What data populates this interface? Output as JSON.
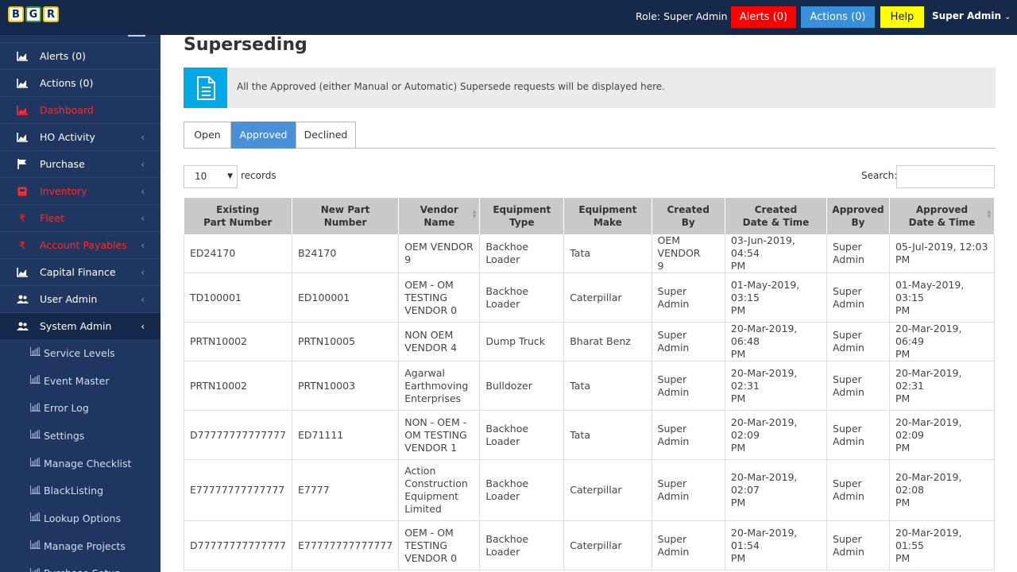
{
  "header": {
    "logo_letters": [
      "B",
      "G",
      "R"
    ],
    "role": "Role: Super Admin",
    "alerts_label": "Alerts (0)",
    "actions_label": "Actions (0)",
    "help_label": "Help",
    "user_label": "Super Admin"
  },
  "sidebar": {
    "items": [
      {
        "label": "Alerts (0)",
        "icon": "chart-icon",
        "color": "#ffffff"
      },
      {
        "label": "Actions (0)",
        "icon": "chart-icon",
        "color": "#ffffff"
      },
      {
        "label": "Dashboard",
        "icon": "chart-icon",
        "color": "#ff2a2a"
      },
      {
        "label": "HO Activity",
        "icon": "chart-icon",
        "color": "#ffffff"
      },
      {
        "label": "Purchase",
        "icon": "flag-icon",
        "color": "#ffffff"
      },
      {
        "label": "Inventory",
        "icon": "box-icon",
        "color": "#ff2a2a"
      },
      {
        "label": "Fleet",
        "icon": "rupee-icon",
        "color": "#ff2a2a"
      },
      {
        "label": "Account Payables",
        "icon": "rupee-icon",
        "color": "#ff2a2a"
      },
      {
        "label": "Capital Finance",
        "icon": "chart-icon",
        "color": "#ffffff"
      },
      {
        "label": "User Admin",
        "icon": "users-icon",
        "color": "#ffffff"
      },
      {
        "label": "System Admin",
        "icon": "users-icon",
        "color": "#ffffff"
      }
    ],
    "subitems": [
      "Service Levels",
      "Event Master",
      "Error Log",
      "Settings",
      "Manage Checklist",
      "BlackListing",
      "Lookup Options",
      "Manage Projects",
      "Purchase Setup"
    ]
  },
  "main": {
    "title": "Superseding",
    "info_text": "All the Approved (either Manual or Automatic) Supersede requests will be displayed here.",
    "tabs": [
      "Open",
      "Approved",
      "Declined"
    ],
    "page_length": "10",
    "records_label": "records",
    "search_label": "Search:"
  },
  "table": {
    "headers": [
      [
        "Existing",
        "Part Number"
      ],
      [
        "New Part",
        "Number"
      ],
      [
        "Vendor Name",
        ""
      ],
      [
        "Equipment Type",
        ""
      ],
      [
        "Equipment Make",
        ""
      ],
      [
        "Created",
        "By"
      ],
      [
        "Created",
        "Date & Time"
      ],
      [
        "Approved",
        "By"
      ],
      [
        "Approved",
        "Date & Time"
      ]
    ],
    "rows": [
      {
        "existing": "ED24170",
        "new": "B24170",
        "vendor": [
          "OEM VENDOR",
          "9"
        ],
        "type": "Backhoe Loader",
        "make": "Tata",
        "created_by": [
          "OEM VENDOR",
          "9"
        ],
        "created_at": [
          "03-Jun-2019, 04:54",
          "PM"
        ],
        "approved_by": [
          "Super",
          "Admin"
        ],
        "approved_at": [
          "05-Jul-2019, 12:03",
          "PM"
        ]
      },
      {
        "existing": "TD100001",
        "new": "ED100001",
        "vendor": [
          "OEM - OM",
          "TESTING",
          "VENDOR 0"
        ],
        "type": "Backhoe Loader",
        "make": "Caterpillar",
        "created_by": [
          "Super Admin"
        ],
        "created_at": [
          "01-May-2019, 03:15",
          "PM"
        ],
        "approved_by": [
          "Super",
          "Admin"
        ],
        "approved_at": [
          "01-May-2019, 03:15",
          "PM"
        ]
      },
      {
        "existing": "PRTN10002",
        "new": "PRTN10005",
        "vendor": [
          "NON OEM",
          "VENDOR 4"
        ],
        "type": "Dump Truck",
        "make": "Bharat Benz",
        "created_by": [
          "Super Admin"
        ],
        "created_at": [
          "20-Mar-2019, 06:48",
          "PM"
        ],
        "approved_by": [
          "Super",
          "Admin"
        ],
        "approved_at": [
          "20-Mar-2019, 06:49",
          "PM"
        ]
      },
      {
        "existing": "PRTN10002",
        "new": "PRTN10003",
        "vendor": [
          "Agarwal",
          "Earthmoving",
          "Enterprises"
        ],
        "type": "Bulldozer",
        "make": "Tata",
        "created_by": [
          "Super Admin"
        ],
        "created_at": [
          "20-Mar-2019, 02:31",
          "PM"
        ],
        "approved_by": [
          "Super",
          "Admin"
        ],
        "approved_at": [
          "20-Mar-2019, 02:31",
          "PM"
        ]
      },
      {
        "existing": "D77777777777777",
        "new": "ED71111",
        "vendor": [
          "NON - OEM -",
          "OM TESTING",
          "VENDOR 1"
        ],
        "type": "Backhoe Loader",
        "make": "Tata",
        "created_by": [
          "Super Admin"
        ],
        "created_at": [
          "20-Mar-2019, 02:09",
          "PM"
        ],
        "approved_by": [
          "Super",
          "Admin"
        ],
        "approved_at": [
          "20-Mar-2019, 02:09",
          "PM"
        ]
      },
      {
        "existing": "E77777777777777",
        "new": "E7777",
        "vendor": [
          "Action",
          "Construction",
          "Equipment",
          "Limited"
        ],
        "type": "Backhoe Loader",
        "make": "Caterpillar",
        "created_by": [
          "Super Admin"
        ],
        "created_at": [
          "20-Mar-2019, 02:07",
          "PM"
        ],
        "approved_by": [
          "Super",
          "Admin"
        ],
        "approved_at": [
          "20-Mar-2019, 02:08",
          "PM"
        ]
      },
      {
        "existing": "D77777777777777",
        "new": "E77777777777777",
        "vendor": [
          "OEM - OM",
          "TESTING",
          "VENDOR 0"
        ],
        "type": "Backhoe Loader",
        "make": "Caterpillar",
        "created_by": [
          "Super Admin"
        ],
        "created_at": [
          "20-Mar-2019, 01:54",
          "PM"
        ],
        "approved_by": [
          "Super",
          "Admin"
        ],
        "approved_at": [
          "20-Mar-2019, 01:55",
          "PM"
        ]
      }
    ]
  }
}
